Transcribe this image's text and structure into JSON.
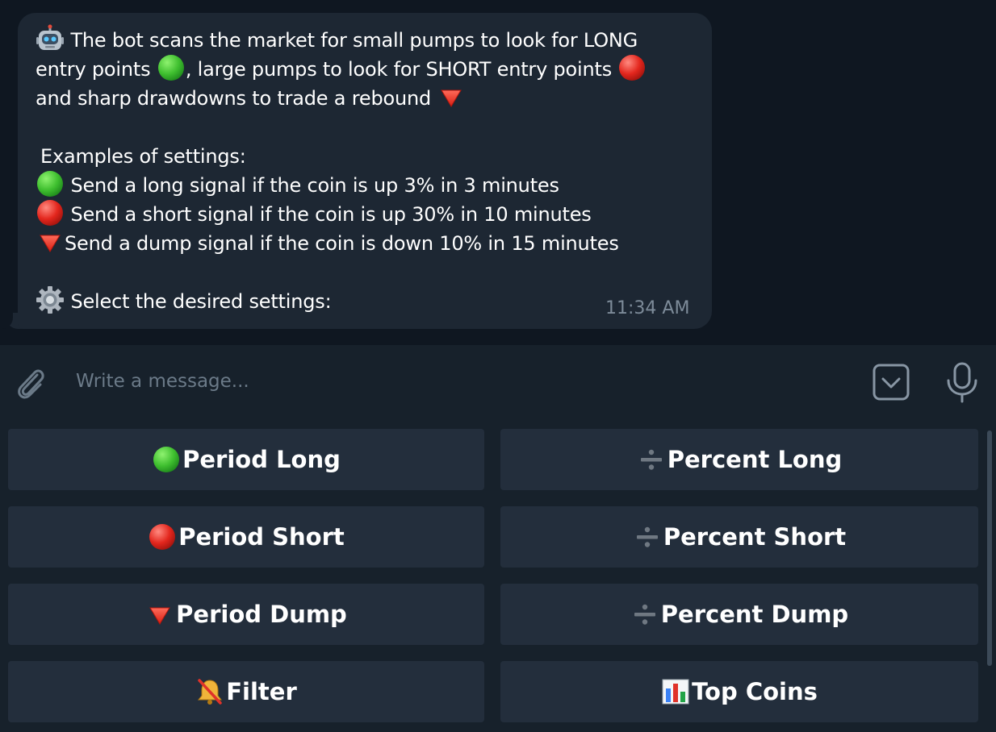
{
  "message": {
    "lines": [
      "The bot scans the market for small pumps to look for LONG",
      "entry points ",
      ", large pumps to look for SHORT entry points ",
      "and sharp drawdowns to trade a rebound ",
      "Examples of settings:",
      "Send a long signal if the coin is up 3% in 3 minutes",
      "Send a short signal if the coin is up 30% in 10 minutes",
      "Send a dump signal if the coin is down 10% in 15 minutes",
      "Select the desired settings:"
    ],
    "timestamp": "11:34 AM"
  },
  "composer": {
    "placeholder": "Write a message..."
  },
  "keyboard": {
    "buttons": [
      {
        "label": "Period Long",
        "icon": "green-circle-icon"
      },
      {
        "label": "Percent Long",
        "icon": "divide-icon"
      },
      {
        "label": "Period Short",
        "icon": "red-circle-icon"
      },
      {
        "label": "Percent Short",
        "icon": "divide-icon"
      },
      {
        "label": "Period Dump",
        "icon": "red-triangle-down-icon"
      },
      {
        "label": "Percent Dump",
        "icon": "divide-icon"
      },
      {
        "label": "Filter",
        "icon": "bell-slash-icon"
      },
      {
        "label": "Top Coins",
        "icon": "bar-chart-icon"
      }
    ]
  },
  "colors": {
    "background": "#0f1721",
    "bubble": "#1d2733",
    "panel": "#17212b",
    "button": "#232e3c",
    "timestamp": "#7d8b99",
    "placeholder": "#6b7a88"
  }
}
